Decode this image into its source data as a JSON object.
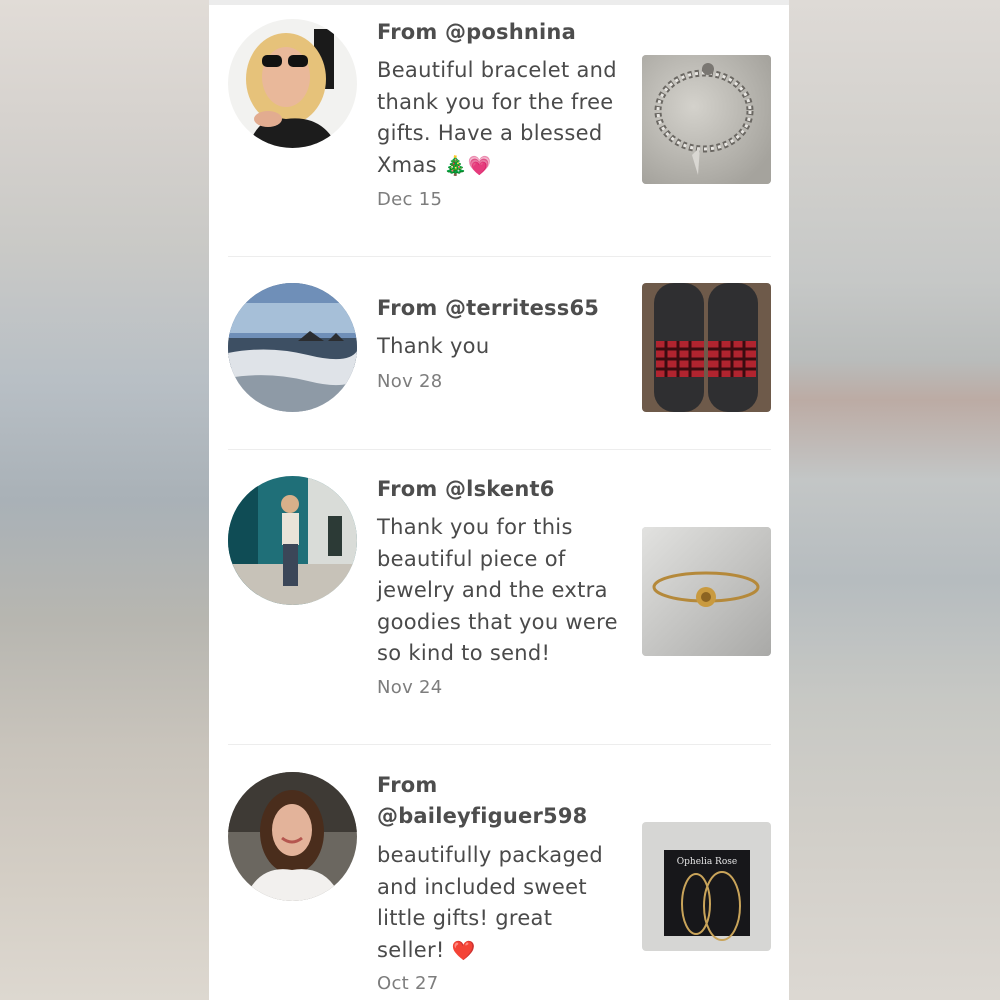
{
  "reviews": [
    {
      "from": "From @poshnina",
      "message": "Beautiful bracelet and thank you for the free gifts. Have a blessed Xmas",
      "emojis": "🎄💗",
      "date": "Dec 15",
      "avatar_icon": "user-photo",
      "thumb_icon": "bracelet-photo"
    },
    {
      "from": "From @territess65",
      "message": "Thank you",
      "emojis": "",
      "date": "Nov 28",
      "avatar_icon": "ocean-photo",
      "thumb_icon": "slides-photo"
    },
    {
      "from": "From @lskent6",
      "message": "Thank you for this beautiful piece of jewelry and the extra goodies that you were so kind to send!",
      "emojis": "",
      "date": "Nov 24",
      "avatar_icon": "user-photo",
      "thumb_icon": "bangle-photo"
    },
    {
      "from": "From @baileyfiguer598",
      "message": "beautifully packaged and included sweet little gifts! great seller!",
      "emojis": "❤️",
      "date": "Oct 27",
      "avatar_icon": "user-photo",
      "thumb_icon": "hoop-earrings-photo"
    }
  ],
  "thumb_label": "Ophelia Rose"
}
